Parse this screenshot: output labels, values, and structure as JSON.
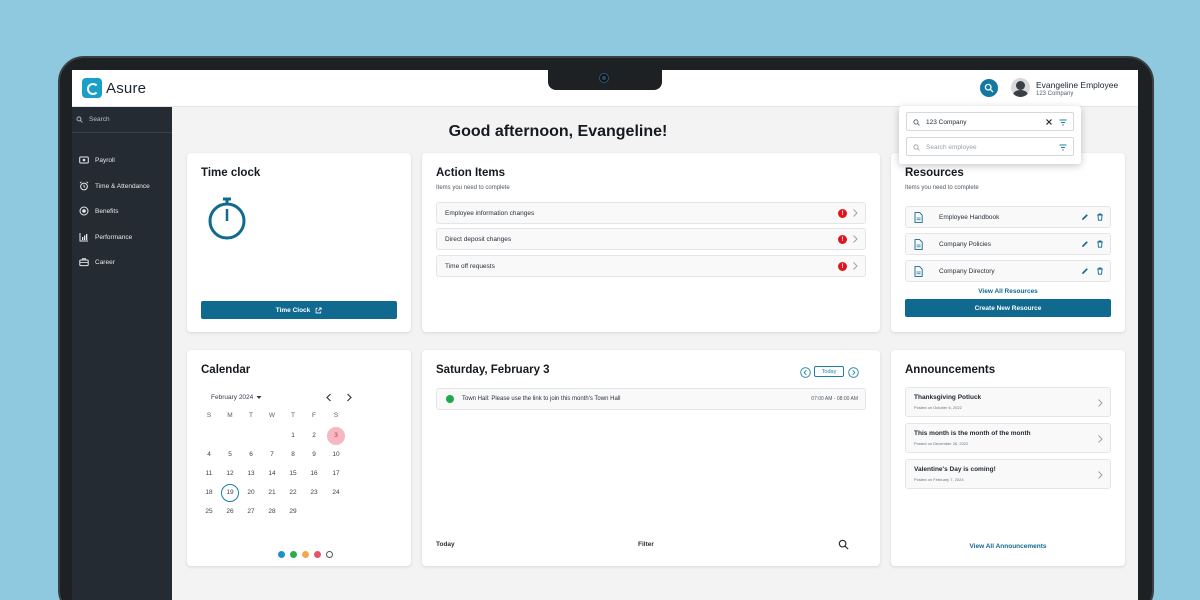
{
  "app": {
    "name": "Asure"
  },
  "user": {
    "name": "Evangeline Employee",
    "company": "123 Company"
  },
  "sidebar": {
    "search_placeholder": "Search",
    "items": [
      {
        "label": "Payroll",
        "icon": "payroll-icon"
      },
      {
        "label": "Time & Attendance",
        "icon": "alarm-clock-icon"
      },
      {
        "label": "Benefits",
        "icon": "benefits-icon"
      },
      {
        "label": "Performance",
        "icon": "bar-chart-icon"
      },
      {
        "label": "Career",
        "icon": "briefcase-icon"
      }
    ]
  },
  "greeting": "Good afternoon, Evangeline!",
  "company_dropdown": {
    "company_value": "123 Company",
    "employee_placeholder": "Search employee"
  },
  "time_clock": {
    "title": "Time clock",
    "button": "Time Clock"
  },
  "action_items": {
    "title": "Action Items",
    "subtitle": "Items you need to complete",
    "rows": [
      {
        "label": "Employee information changes",
        "badge": "!"
      },
      {
        "label": "Direct deposit changes",
        "badge": "!"
      },
      {
        "label": "Time off requests",
        "badge": "!"
      }
    ]
  },
  "resources": {
    "title": "Resources",
    "subtitle": "Items you need to complete",
    "rows": [
      {
        "label": "Employee Handbook"
      },
      {
        "label": "Company Policies"
      },
      {
        "label": "Company Directory"
      }
    ],
    "view_all": "View All Resources",
    "create": "Create New Resource"
  },
  "calendar": {
    "title": "Calendar",
    "month": "February 2024",
    "weekdays": [
      "S",
      "M",
      "T",
      "W",
      "T",
      "F",
      "S"
    ],
    "weeks": [
      [
        "",
        "",
        "",
        "",
        "1",
        "2",
        "3"
      ],
      [
        "4",
        "5",
        "6",
        "7",
        "8",
        "9",
        "10"
      ],
      [
        "11",
        "12",
        "13",
        "14",
        "15",
        "16",
        "17"
      ],
      [
        "18",
        "19",
        "20",
        "21",
        "22",
        "23",
        "24"
      ],
      [
        "25",
        "26",
        "27",
        "28",
        "29",
        "",
        ""
      ]
    ],
    "selected_day": "3",
    "today_day": "19",
    "legend_colors": [
      "#1f8fc4",
      "#2eaa55",
      "#f2a94b",
      "#e8526b",
      "#ffffff"
    ]
  },
  "day_view": {
    "title": "Saturday, February 3",
    "today_button": "Today",
    "event": {
      "text": "Town Hall: Please use the link to join this month's Town Hall",
      "time": "07:00 AM - 08:00 AM"
    },
    "footer": {
      "today": "Today",
      "filter": "Filter"
    }
  },
  "announcements": {
    "title": "Announcements",
    "items": [
      {
        "title": "Thanksgiving Potluck",
        "date": "Posted on October 6, 2022"
      },
      {
        "title": "This month is the month of the month",
        "date": "Posted on December 26, 2022"
      },
      {
        "title": "Valentine's Day is coming!",
        "date": "Posted on February 7, 2024"
      }
    ],
    "view_all": "View All Announcements"
  },
  "colors": {
    "brand": "#10698f",
    "sidebar": "#252b33",
    "alert": "#e0161e",
    "accent": "#1a9fc9"
  }
}
